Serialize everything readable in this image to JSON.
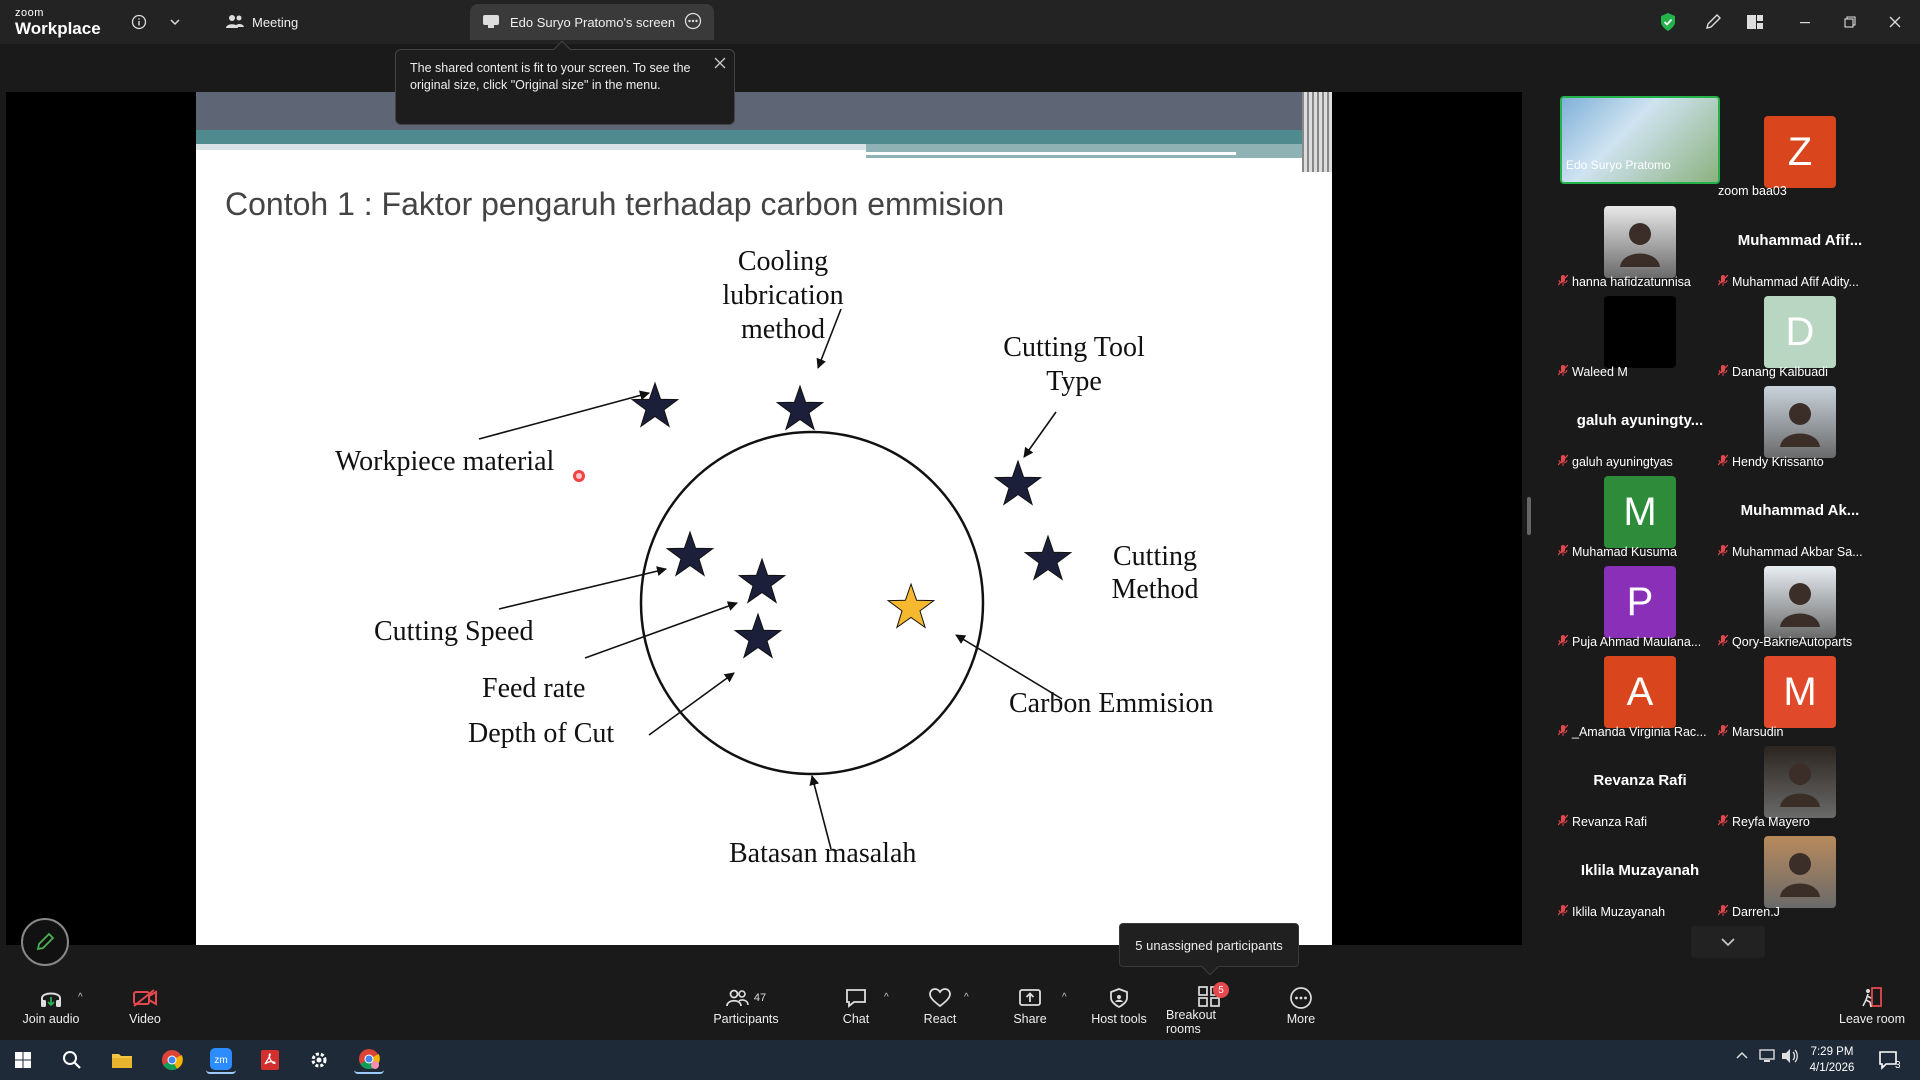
{
  "titlebar": {
    "brand_small": "zoom",
    "brand_big": "Workplace",
    "meeting_tab": "Meeting",
    "screen_tab": "Edo Suryo Pratomo's screen"
  },
  "tooltip": {
    "text": "The shared content is fit to your screen. To see the original size, click \"Original size\" in the menu."
  },
  "slide": {
    "title": "Contoh 1 : Faktor pengaruh terhadap carbon emmision",
    "labels": {
      "cooling_l1": "Cooling",
      "cooling_l2": "lubrication",
      "cooling_l3": "method",
      "cutting_tool_l1": "Cutting Tool",
      "cutting_tool_l2": "Type",
      "workpiece": "Workpiece material",
      "cutting_method_l1": "Cutting",
      "cutting_method_l2": "Method",
      "cutting_speed": "Cutting Speed",
      "feed_rate": "Feed rate",
      "depth_of_cut": "Depth of Cut",
      "carbon_emmision": "Carbon Emmision",
      "batasan": "Batasan masalah"
    }
  },
  "gallery": {
    "tiles": [
      {
        "label": "Edo Suryo Pratomo",
        "muted": false,
        "type": "sharer"
      },
      {
        "label": "zoom baa03",
        "muted": false,
        "type": "avatar",
        "initial": "Z",
        "color": "#d9461e"
      },
      {
        "label": "hanna hafidzatunnisa",
        "muted": true,
        "type": "photo",
        "color": "#e8e8e8"
      },
      {
        "label": "Muhammad Afif Adity...",
        "muted": true,
        "type": "name",
        "display": "Muhammad  Afif..."
      },
      {
        "label": "Waleed M",
        "muted": true,
        "type": "blank",
        "color": "#000000"
      },
      {
        "label": "Danang Kalbuadi",
        "muted": true,
        "type": "avatar",
        "initial": "D",
        "color": "#b8d6c2"
      },
      {
        "label": "galuh ayuningtyas",
        "muted": true,
        "type": "name",
        "display": "galuh  ayuningty..."
      },
      {
        "label": "Hendy Krissanto",
        "muted": true,
        "type": "photo",
        "color": "#c9d3dc"
      },
      {
        "label": "Muhamad Kusuma",
        "muted": true,
        "type": "avatar",
        "initial": "M",
        "color": "#2e8b3a"
      },
      {
        "label": "Muhammad Akbar Sa...",
        "muted": true,
        "type": "name",
        "display": "Muhammad  Ak..."
      },
      {
        "label": "Puja Ahmad Maulana...",
        "muted": true,
        "type": "avatar",
        "initial": "P",
        "color": "#8a2fb8"
      },
      {
        "label": "Qory-BakrieAutoparts",
        "muted": true,
        "type": "photo",
        "color": "#e9eef3"
      },
      {
        "label": "_Amanda Virginia Rac...",
        "muted": true,
        "type": "avatar",
        "initial": "A",
        "color": "#d9461e"
      },
      {
        "label": "Marsudin",
        "muted": true,
        "type": "avatar",
        "initial": "M",
        "color": "#e04a2a"
      },
      {
        "label": "Revanza Rafi",
        "muted": true,
        "type": "name",
        "display": "Revanza Rafi"
      },
      {
        "label": "Reyfa Mayero",
        "muted": true,
        "type": "photo",
        "color": "#2b2520"
      },
      {
        "label": "Iklila Muzayanah",
        "muted": true,
        "type": "name",
        "display": "Iklila Muzayanah"
      },
      {
        "label": "Darren.J",
        "muted": true,
        "type": "photo",
        "color": "#b88a5c"
      }
    ]
  },
  "popup": {
    "unassigned": "5 unassigned participants"
  },
  "toolbar": {
    "join_audio": "Join audio",
    "video": "Video",
    "participants": "Participants",
    "participants_count": "47",
    "chat": "Chat",
    "react": "React",
    "share": "Share",
    "host_tools": "Host tools",
    "breakout_rooms": "Breakout rooms",
    "breakout_badge": "5",
    "more": "More",
    "leave_room": "Leave room"
  },
  "taskbar": {
    "time": "7:29 PM",
    "date": "4/1/2026",
    "notifications": "3"
  },
  "colors": {
    "accent_green": "#24b24a",
    "muted_red": "#e5484d",
    "star_gold": "#f5b82e",
    "star_navy": "#1b1f3a"
  }
}
